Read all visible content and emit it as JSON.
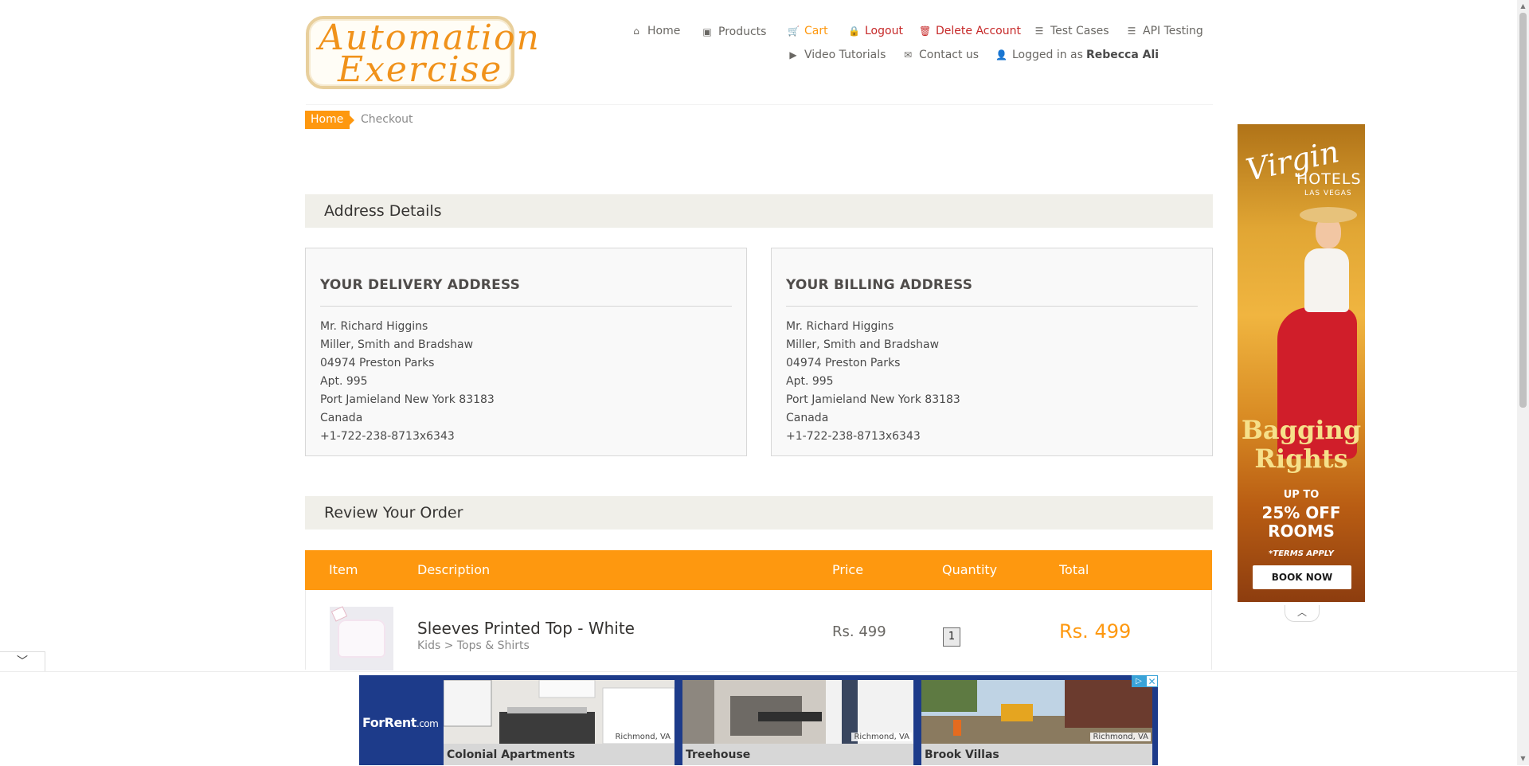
{
  "logo": {
    "line1": "Automation",
    "line2": "Exercise"
  },
  "nav": {
    "home": "Home",
    "products": "Products",
    "cart": "Cart",
    "logout": "Logout",
    "delete_account": "Delete Account",
    "test_cases": "Test Cases",
    "api_testing": "API Testing",
    "video_tutorials": "Video Tutorials",
    "contact_us": "Contact us",
    "logged_in_prefix": "Logged in as",
    "logged_in_user": "Rebecca Ali"
  },
  "breadcrumb": {
    "home": "Home",
    "current": "Checkout"
  },
  "sections": {
    "address_details": "Address Details",
    "review_order": "Review Your Order"
  },
  "delivery_address": {
    "title": "YOUR DELIVERY ADDRESS",
    "lines": [
      "Mr. Richard Higgins",
      "Miller, Smith and Bradshaw",
      "04974 Preston Parks",
      "Apt. 995",
      "Port Jamieland New York 83183",
      "Canada",
      "+1-722-238-8713x6343"
    ]
  },
  "billing_address": {
    "title": "YOUR BILLING ADDRESS",
    "lines": [
      "Mr. Richard Higgins",
      "Miller, Smith and Bradshaw",
      "04974 Preston Parks",
      "Apt. 995",
      "Port Jamieland New York 83183",
      "Canada",
      "+1-722-238-8713x6343"
    ]
  },
  "order_table": {
    "headers": {
      "item": "Item",
      "description": "Description",
      "price": "Price",
      "quantity": "Quantity",
      "total": "Total"
    },
    "rows": [
      {
        "name": "Sleeves Printed Top - White",
        "category": "Kids > Tops & Shirts",
        "price": "Rs. 499",
        "quantity": "1",
        "total": "Rs. 499"
      }
    ]
  },
  "side_ad": {
    "brand": "Virgin",
    "hotels": "HOTELS",
    "location": "LAS VEGAS",
    "headline_1": "Bagging",
    "headline_2": "Rights",
    "upto": "UP TO",
    "offer_1": "25% OFF",
    "offer_2": "ROOMS",
    "terms": "*TERMS APPLY",
    "cta": "BOOK NOW"
  },
  "bottom_ad": {
    "brand": "ForRent",
    "brand_suffix": ".com",
    "listings": [
      {
        "name": "Colonial Apartments",
        "location": "Richmond, VA"
      },
      {
        "name": "Treehouse",
        "location": "Richmond, VA"
      },
      {
        "name": "Brook Villas",
        "location": "Richmond, VA"
      }
    ]
  },
  "colors": {
    "accent": "#fe980f",
    "danger": "#c62828",
    "section_bg": "#f0efe9",
    "ad_blue": "#1d3b8a"
  }
}
